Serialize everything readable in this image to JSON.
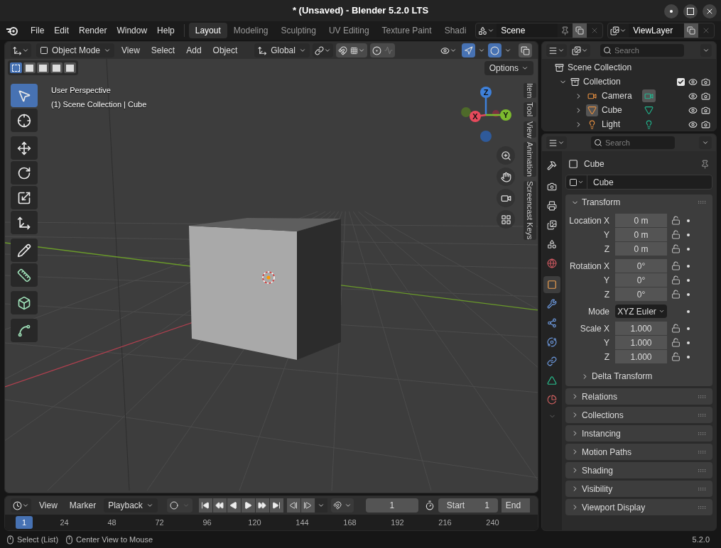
{
  "window": {
    "title": "* (Unsaved) - Blender 5.2.0 LTS"
  },
  "menus": [
    "File",
    "Edit",
    "Render",
    "Window",
    "Help"
  ],
  "workspaces": [
    {
      "label": "Layout",
      "selected": true
    },
    {
      "label": "Modeling",
      "selected": false
    },
    {
      "label": "Sculpting",
      "selected": false
    },
    {
      "label": "UV Editing",
      "selected": false
    },
    {
      "label": "Texture Paint",
      "selected": false
    },
    {
      "label": "Shadi",
      "selected": false
    }
  ],
  "scene": "Scene",
  "view_layer": "ViewLayer",
  "viewport": {
    "mode": "Object Mode",
    "menus": [
      "View",
      "Select",
      "Add",
      "Object"
    ],
    "orientation": "Global",
    "gizmos_on": true,
    "overlays_on": true,
    "xray_on": false,
    "select_modes": [
      {
        "selected": true
      },
      {
        "selected": false
      },
      {
        "selected": false
      },
      {
        "selected": false
      },
      {
        "selected": false
      }
    ],
    "options": "Options",
    "info": [
      "User Perspective",
      "(1) Scene Collection | Cube"
    ],
    "tool_groups": [
      [
        {
          "kind": "select_box",
          "selected": true
        },
        {
          "kind": "cursor",
          "selected": false
        }
      ],
      [
        {
          "kind": "move",
          "selected": false
        },
        {
          "kind": "rotate",
          "selected": false
        },
        {
          "kind": "scale",
          "selected": false
        },
        {
          "kind": "transform",
          "selected": false
        }
      ],
      [
        {
          "kind": "annotate",
          "selected": false
        },
        {
          "kind": "measure",
          "selected": false
        }
      ],
      [
        {
          "kind": "add_cube",
          "selected": false
        }
      ],
      [
        {
          "kind": "shear",
          "selected": false
        }
      ]
    ],
    "gizmo_axes": [
      {
        "kind": "z",
        "label": "Z"
      },
      {
        "kind": "x",
        "label": "X"
      },
      {
        "kind": "y",
        "label": "Y"
      }
    ],
    "sidebar_tabs": [
      "Item",
      "Tool",
      "View",
      "Animation",
      "Screencast Keys"
    ]
  },
  "timeline": {
    "menus": [
      "View",
      "Marker"
    ],
    "playback": "Playback",
    "current_frame": "1",
    "start_label": "Start",
    "start": "1",
    "end_label": "End",
    "ruler": [
      {
        "label": "1",
        "selected": true
      },
      {
        "label": "24",
        "selected": false
      },
      {
        "label": "48",
        "selected": false
      },
      {
        "label": "72",
        "selected": false
      },
      {
        "label": "96",
        "selected": false
      },
      {
        "label": "120",
        "selected": false
      },
      {
        "label": "144",
        "selected": false
      },
      {
        "label": "168",
        "selected": false
      },
      {
        "label": "192",
        "selected": false
      },
      {
        "label": "216",
        "selected": false
      },
      {
        "label": "240",
        "selected": false
      }
    ]
  },
  "outliner": {
    "search_placeholder": "Search",
    "root": "Scene Collection",
    "items": [
      {
        "name": "Collection",
        "kind": "collection",
        "expanded": true,
        "checked": true,
        "children": [
          {
            "name": "Camera",
            "kind": "camera",
            "expanded": false,
            "selected": false,
            "data_active": true
          },
          {
            "name": "Cube",
            "kind": "mesh",
            "expanded": false,
            "selected": true,
            "data_active": false
          },
          {
            "name": "Light",
            "kind": "light",
            "expanded": false,
            "selected": false,
            "data_active": false
          }
        ]
      }
    ]
  },
  "properties": {
    "search_placeholder": "Search",
    "tab_groups": [
      [
        {
          "kind": "tool",
          "selected": false
        }
      ],
      [
        {
          "kind": "render",
          "selected": false
        },
        {
          "kind": "output",
          "selected": false
        },
        {
          "kind": "view_layer",
          "selected": false
        },
        {
          "kind": "scene",
          "selected": false
        },
        {
          "kind": "world",
          "selected": false
        }
      ],
      [
        {
          "kind": "object",
          "selected": true
        },
        {
          "kind": "modifiers",
          "selected": false
        },
        {
          "kind": "particles",
          "selected": false
        },
        {
          "kind": "physics",
          "selected": false
        },
        {
          "kind": "constraints",
          "selected": false
        },
        {
          "kind": "data",
          "selected": false
        },
        {
          "kind": "material",
          "selected": false
        }
      ]
    ],
    "object_name": "Cube",
    "datablock": "Cube",
    "transform": {
      "title": "Transform",
      "expanded": true,
      "groups": [
        [
          {
            "label": "Location X",
            "value": "0 m",
            "kind": "number"
          },
          {
            "label": "Y",
            "value": "0 m",
            "kind": "number"
          },
          {
            "label": "Z",
            "value": "0 m",
            "kind": "number"
          }
        ],
        [
          {
            "label": "Rotation X",
            "value": "0°",
            "kind": "number"
          },
          {
            "label": "Y",
            "value": "0°",
            "kind": "number"
          },
          {
            "label": "Z",
            "value": "0°",
            "kind": "number"
          }
        ],
        [
          {
            "label": "Mode",
            "value": "XYZ Euler",
            "kind": "enum"
          }
        ],
        [
          {
            "label": "Scale X",
            "value": "1.000",
            "kind": "number"
          },
          {
            "label": "Y",
            "value": "1.000",
            "kind": "number"
          },
          {
            "label": "Z",
            "value": "1.000",
            "kind": "number"
          }
        ]
      ],
      "subpanel": {
        "title": "Delta Transform",
        "expanded": false
      }
    },
    "panels": [
      {
        "title": "Relations",
        "expanded": false
      },
      {
        "title": "Collections",
        "expanded": false
      },
      {
        "title": "Instancing",
        "expanded": false
      },
      {
        "title": "Motion Paths",
        "expanded": false
      },
      {
        "title": "Shading",
        "expanded": false
      },
      {
        "title": "Visibility",
        "expanded": false
      },
      {
        "title": "Viewport Display",
        "expanded": false
      }
    ]
  },
  "status": {
    "hints": [
      "Select (List)",
      "Center View to Mouse"
    ],
    "version": "5.2.0"
  }
}
